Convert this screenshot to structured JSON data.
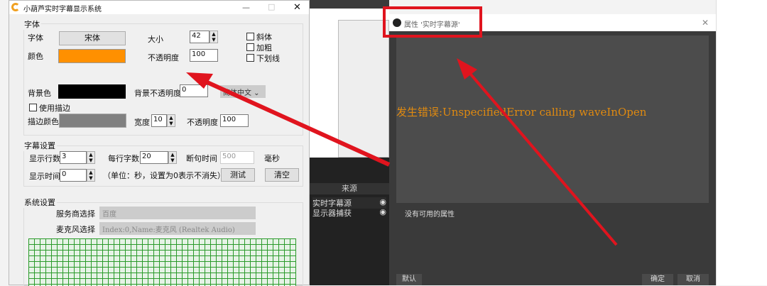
{
  "app": {
    "title": "小葫芦实时字幕显示系统",
    "minimize": "—",
    "maximize": "□",
    "close": "✕"
  },
  "font_group": {
    "title": "字体",
    "font_label": "字体",
    "font_button": "宋体",
    "size_label": "大小",
    "size_value": "42",
    "color_label": "颜色",
    "color": "#ff9000",
    "opacity_label": "不透明度",
    "opacity_value": "100",
    "italic": "斜体",
    "bold": "加粗",
    "underline": "下划线",
    "bg_label": "背景色",
    "bg_color": "#000000",
    "bg_opacity_label": "背景不透明度",
    "bg_opacity_value": "0",
    "language": "简体中文",
    "use_stroke": "使用描边",
    "stroke_color_label": "描边颜色",
    "stroke_color": "#808080",
    "width_label": "宽度",
    "width_value": "10",
    "stroke_opacity_label": "不透明度",
    "stroke_opacity_value": "100"
  },
  "subtitle_group": {
    "title": "字幕设置",
    "lines_label": "显示行数",
    "lines_value": "3",
    "chars_label": "每行字数",
    "chars_value": "20",
    "break_label": "断句时间",
    "break_value": "500",
    "ms": "毫秒",
    "time_label": "显示时间",
    "time_value": "0",
    "hint": "（单位：秒，设置为0表示不消失）",
    "test": "测试",
    "clear": "清空"
  },
  "system_group": {
    "title": "系统设置",
    "provider_label": "服务商选择",
    "provider_value": "百度",
    "mic_label": "麦克风选择",
    "mic_value": "Index:0,Name:麦克风 (Realtek Audio)"
  },
  "obs": {
    "sources_title": "来源",
    "sources": [
      "实时字幕源",
      "显示器捕获"
    ]
  },
  "dialog": {
    "title": "属性 '实时字幕源'",
    "close": "✕",
    "error": "发生错误:UnspecifiedError calling waveInOpen",
    "no_props": "没有可用的属性",
    "defaults": "默认",
    "ok": "确定",
    "cancel": "取消"
  }
}
